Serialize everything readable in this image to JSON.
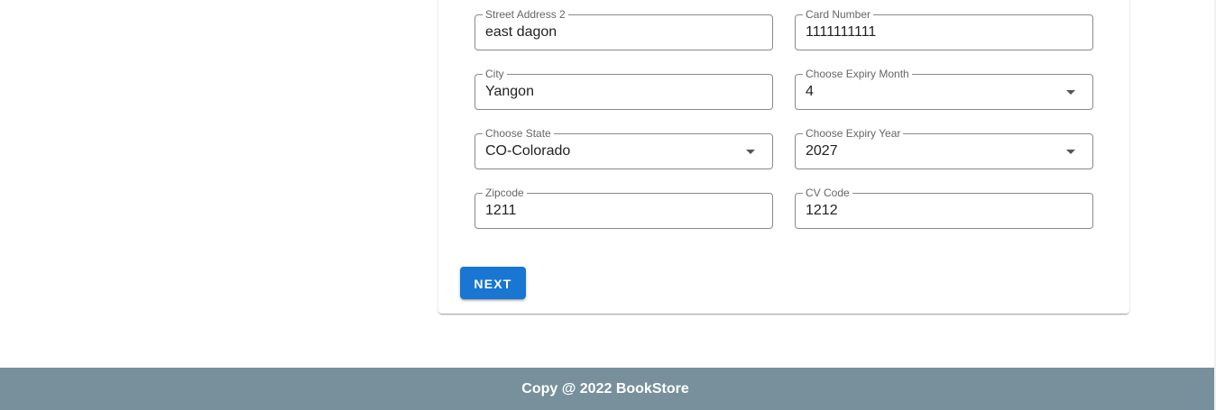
{
  "form": {
    "street_address_2": {
      "label": "Street Address 2",
      "value": "east dagon"
    },
    "city": {
      "label": "City",
      "value": "Yangon"
    },
    "state": {
      "label": "Choose State",
      "value": "CO-Colorado"
    },
    "zipcode": {
      "label": "Zipcode",
      "value": "1211"
    },
    "card_number": {
      "label": "Card Number",
      "value": "1111111111"
    },
    "expiry_month": {
      "label": "Choose Expiry Month",
      "value": "4"
    },
    "expiry_year": {
      "label": "Choose Expiry Year",
      "value": "2027"
    },
    "cv_code": {
      "label": "CV Code",
      "value": "1212"
    },
    "next_label": "NEXT"
  },
  "footer": {
    "text": "Copy @ 2022 BookStore"
  },
  "colors": {
    "primary": "#1976d2",
    "footer_bg": "#78909c"
  },
  "icons": {
    "dropdown": "chevron-down-icon"
  }
}
